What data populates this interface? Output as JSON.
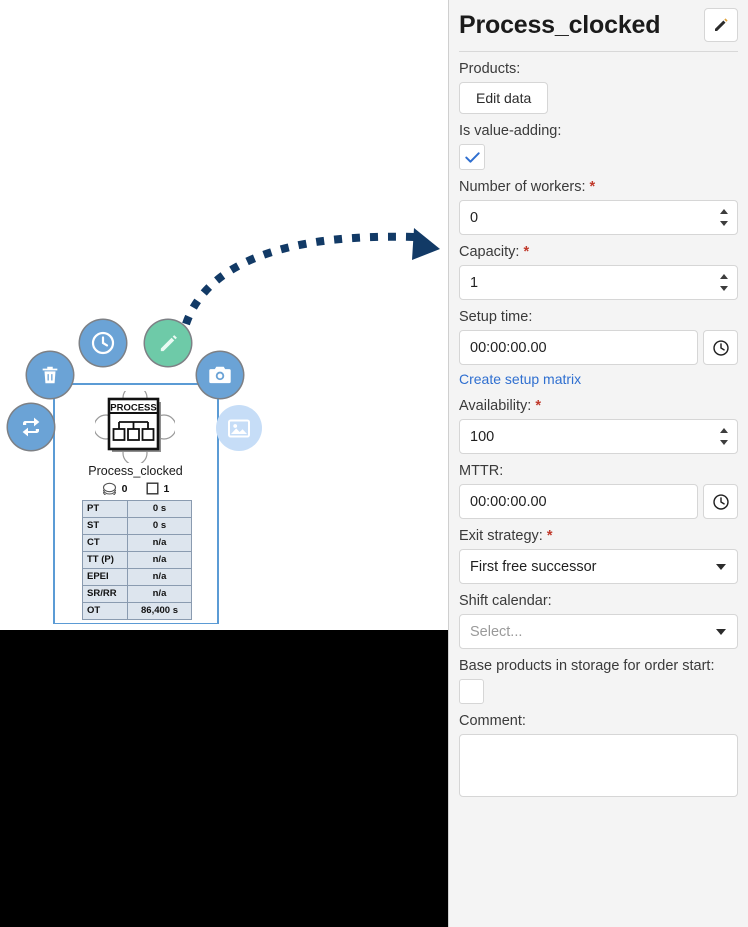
{
  "panel": {
    "title": "Process_clocked",
    "edit_button_icon": "pencil-icon",
    "fields": {
      "products_label": "Products:",
      "edit_data_button": "Edit data",
      "value_adding_label": "Is value-adding:",
      "value_adding_checked": true,
      "workers_label": "Number of workers:",
      "workers_required": "*",
      "workers_value": "0",
      "capacity_label": "Capacity:",
      "capacity_required": "*",
      "capacity_value": "1",
      "setup_time_label": "Setup time:",
      "setup_time_value": "00:00:00.00",
      "setup_matrix_link": "Create setup matrix",
      "availability_label": "Availability:",
      "availability_required": "*",
      "availability_value": "100",
      "mttr_label": "MTTR:",
      "mttr_value": "00:00:00.00",
      "exit_strategy_label": "Exit strategy:",
      "exit_strategy_required": "*",
      "exit_strategy_value": "First free successor",
      "shift_calendar_label": "Shift calendar:",
      "shift_calendar_placeholder": "Select...",
      "base_products_label": "Base products in storage for order start:",
      "base_products_checked": false,
      "comment_label": "Comment:",
      "comment_value": ""
    }
  },
  "canvas": {
    "node": {
      "icon_caption": "PROCESS",
      "label": "Process_clocked",
      "badge_disc_value": "0",
      "badge_square_value": "1",
      "kpi_rows": [
        {
          "key": "PT",
          "value": "0 s"
        },
        {
          "key": "ST",
          "value": "0 s"
        },
        {
          "key": "CT",
          "value": "n/a"
        },
        {
          "key": "TT (P)",
          "value": "n/a"
        },
        {
          "key": "EPEI",
          "value": "n/a"
        },
        {
          "key": "SR/RR",
          "value": "n/a"
        },
        {
          "key": "OT",
          "value": "86,400 s"
        }
      ]
    },
    "actions": [
      {
        "name": "delete-action-button",
        "icon": "trash-icon",
        "style": "blue"
      },
      {
        "name": "history-action-button",
        "icon": "clock-icon",
        "style": "blue"
      },
      {
        "name": "edit-action-button",
        "icon": "pencil-icon",
        "style": "green"
      },
      {
        "name": "snapshot-action-button",
        "icon": "camera-icon",
        "style": "blue"
      },
      {
        "name": "image-action-button",
        "icon": "image-icon",
        "style": "ghost"
      },
      {
        "name": "replace-action-button",
        "icon": "exchange-icon",
        "style": "blue"
      }
    ],
    "annotation_arrow": "curved-dotted-arrow"
  },
  "colors": {
    "accent_blue": "#6ba3d6",
    "accent_green": "#6ecaa8",
    "arrow_navy": "#123a66",
    "link_blue": "#2f6fd0",
    "required_red": "#c0392b",
    "selection_blue": "#5b9bd5",
    "table_fill": "#dde5ee"
  }
}
